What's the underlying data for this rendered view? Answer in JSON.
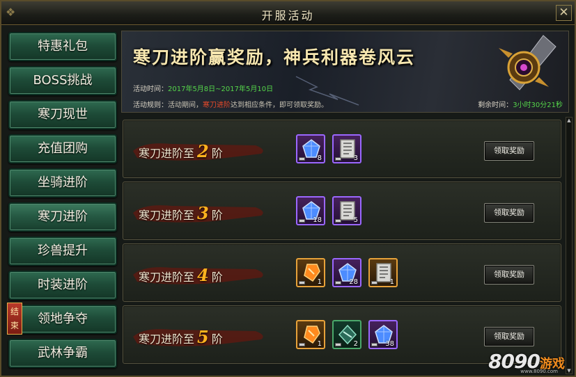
{
  "window": {
    "title": "开服活动",
    "close_label": "✕"
  },
  "sidebar": {
    "items": [
      {
        "label": "特惠礼包"
      },
      {
        "label": "BOSS挑战"
      },
      {
        "label": "寒刀现世"
      },
      {
        "label": "充值团购"
      },
      {
        "label": "坐骑进阶"
      },
      {
        "label": "寒刀进阶"
      },
      {
        "label": "珍兽提升"
      },
      {
        "label": "时装进阶"
      },
      {
        "label": "领地争夺",
        "tag": "结束"
      },
      {
        "label": "武林争霸"
      }
    ],
    "active_index": 5
  },
  "banner": {
    "slogan": "寒刀进阶赢奖励，神兵利器卷风云",
    "time_label": "活动时间：",
    "time_value": "2017年5月8日~2017年5月10日",
    "rule_label": "活动规则：",
    "rule_pre": "活动期间，",
    "rule_highlight": "寒刀进阶",
    "rule_post": "达到相应条件，即可领取奖励。",
    "remain_label": "剩余时间：",
    "remain_value": "3小时30分21秒"
  },
  "rewards": [
    {
      "prefix": "寒刀进阶至",
      "level": "2",
      "suffix": "阶",
      "claim_label": "领取奖励",
      "items": [
        {
          "icon": "blue-gem-icon",
          "qty": "8"
        },
        {
          "icon": "scroll-icon",
          "qty": "3"
        }
      ]
    },
    {
      "prefix": "寒刀进阶至",
      "level": "3",
      "suffix": "阶",
      "claim_label": "领取奖励",
      "items": [
        {
          "icon": "blue-gem-icon",
          "qty": "18"
        },
        {
          "icon": "scroll-icon",
          "qty": "5"
        }
      ]
    },
    {
      "prefix": "寒刀进阶至",
      "level": "4",
      "suffix": "阶",
      "claim_label": "领取奖励",
      "items": [
        {
          "icon": "orange-gem-icon",
          "qty": "1"
        },
        {
          "icon": "blue-gem-icon",
          "qty": "28"
        },
        {
          "icon": "scroll-icon",
          "qty": "1"
        }
      ]
    },
    {
      "prefix": "寒刀进阶至",
      "level": "5",
      "suffix": "阶",
      "claim_label": "领取奖励",
      "items": [
        {
          "icon": "orange-gem-icon",
          "qty": "1"
        },
        {
          "icon": "green-crystal-icon",
          "qty": "2"
        },
        {
          "icon": "blue-gem-icon",
          "qty": "38"
        }
      ]
    }
  ],
  "watermark": {
    "digits": "8090",
    "cn": "游戏",
    "url": "www.8090.com"
  },
  "colors": {
    "accent_gold": "#ffb21e",
    "highlight_red": "#e84a2a",
    "time_green": "#55d64a"
  }
}
